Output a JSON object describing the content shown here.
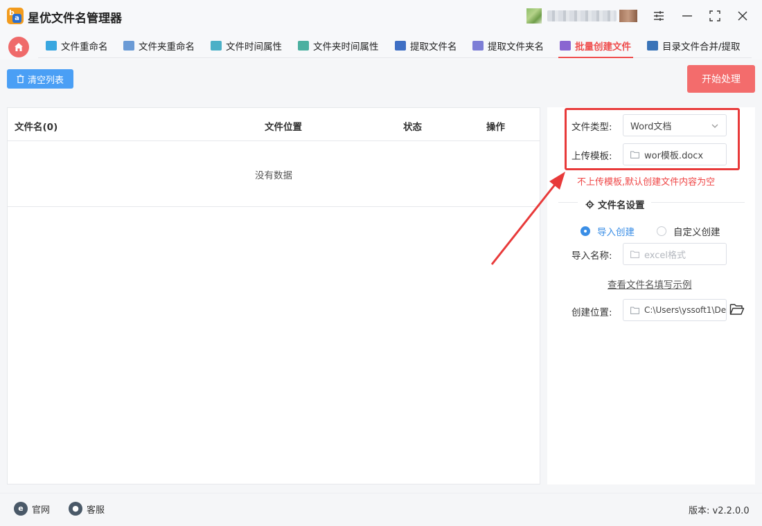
{
  "app": {
    "title": "星优文件名管理器",
    "logo_letter_b": "b",
    "logo_letter_a": "a"
  },
  "nav": {
    "tabs": [
      {
        "label": "文件重命名",
        "icon": "rename-file-icon",
        "color": "#39a7e0"
      },
      {
        "label": "文件夹重命名",
        "icon": "rename-folder-icon",
        "color": "#6b9bd6"
      },
      {
        "label": "文件时间属性",
        "icon": "file-time-icon",
        "color": "#4cb0c7"
      },
      {
        "label": "文件夹时间属性",
        "icon": "folder-time-icon",
        "color": "#4cb0a0"
      },
      {
        "label": "提取文件名",
        "icon": "extract-filename-icon",
        "color": "#3f6fc4"
      },
      {
        "label": "提取文件夹名",
        "icon": "extract-foldername-icon",
        "color": "#7d7ed6"
      },
      {
        "label": "批量创建文件",
        "icon": "batch-create-icon",
        "color": "#8a66d1",
        "active": true
      },
      {
        "label": "目录文件合并/提取",
        "icon": "merge-extract-icon",
        "color": "#3a74b8"
      }
    ]
  },
  "toolbar": {
    "clear_label": "清空列表",
    "start_label": "开始处理"
  },
  "table": {
    "headers": [
      "文件名(0)",
      "文件位置",
      "状态",
      "操作"
    ],
    "empty_text": "没有数据"
  },
  "settings": {
    "file_type_label": "文件类型:",
    "file_type_value": "Word文档",
    "upload_template_label": "上传模板:",
    "upload_template_value": "wor模板.docx",
    "hint": "不上传模板,默认创建文件内容为空",
    "section_title": "文件名设置",
    "radio_import": "导入创建",
    "radio_custom": "自定义创建",
    "import_name_label": "导入名称:",
    "import_name_placeholder": "excel格式",
    "example_link": "查看文件名填写示例",
    "create_location_label": "创建位置:",
    "create_location_value": "C:\\Users\\yssoft1\\De"
  },
  "footer": {
    "website": "官网",
    "support": "客服",
    "version": "版本: v2.2.0.0"
  },
  "colors": {
    "accent_red": "#ef4d4d",
    "primary_blue": "#4a9ff5",
    "highlight": "#e83a3a"
  }
}
